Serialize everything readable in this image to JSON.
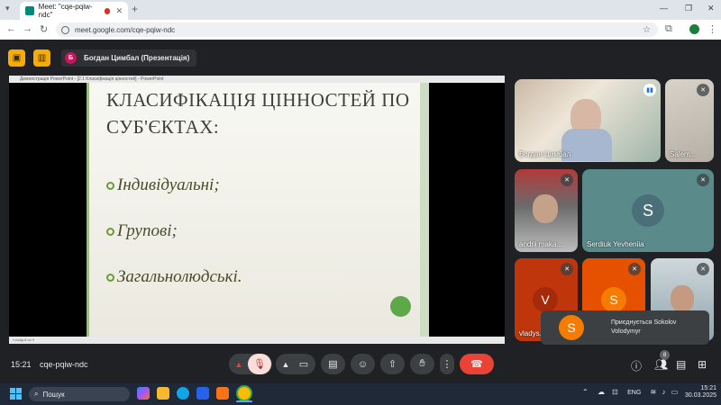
{
  "browser": {
    "tab_title": "Meet: \"cqe-pqiw-ndc\"",
    "tab_close": "✕",
    "new_tab": "+",
    "url": "meet.google.com/cqe-pqiw-ndc"
  },
  "meet": {
    "presenter_initial": "Б",
    "presenter_label": "Богдан Цимбал (Презентація)",
    "meeting_time": "15:21",
    "meeting_code": "cqe-pqiw-ndc",
    "participants_count": "8"
  },
  "presentation": {
    "window_title": "Демонстрація PowerPoint - [2.1 Класифікація цінностей] - PowerPoint",
    "status": "Слайд 8 из 9",
    "slide_title": "КЛАСИФІКАЦІЯ ЦІННОСТЕЙ ПО СУБ'ЄКТАХ:",
    "bullets": [
      "Індивідуальні;",
      "Групові;",
      "Загальнолюдські."
    ]
  },
  "participants": [
    {
      "name": "Богдан Цимбал"
    },
    {
      "name": "Salem..."
    },
    {
      "name": "andrii maka..."
    },
    {
      "name": "Serdiuk Yevheniia",
      "initial": "S"
    },
    {
      "name": "vladys...",
      "initial": "V"
    },
    {
      "name": "",
      "initial": "S"
    },
    {
      "name": ""
    }
  ],
  "notification": {
    "initial": "S",
    "text": "Приєднується Sokolov Volodymyr"
  },
  "taskbar": {
    "search_label": "Пошук",
    "lang": "ENG",
    "time": "15:21",
    "date": "30.03.2025"
  },
  "colors": {
    "meet_bg": "#202124",
    "accent_yellow": "#f9ab00",
    "end_call_red": "#ea4335",
    "avatar_teal": "#009688",
    "avatar_orange": "#f57c00"
  }
}
